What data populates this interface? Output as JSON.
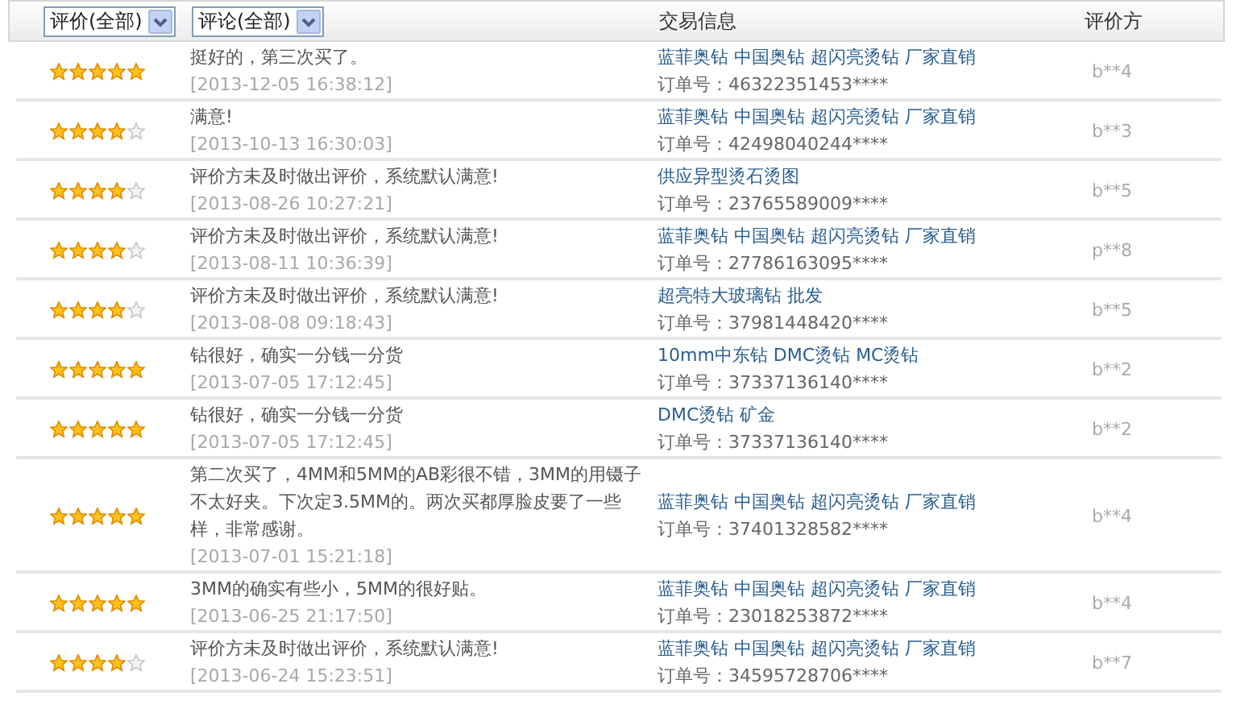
{
  "header": {
    "filters": [
      {
        "label": "评价(全部)"
      },
      {
        "label": "评论(全部)"
      }
    ],
    "columns": [
      "交易信息",
      "评价方"
    ]
  },
  "reviews": [
    {
      "stars": 5,
      "comment": "挺好的，第三次买了。",
      "date": "[2013-12-05 16:38:12]",
      "product": "蓝菲奥钻 中国奥钻 超闪亮烫钻 厂家直销",
      "order": "订单号：46322351453****",
      "rater": "b**4"
    },
    {
      "stars": 4,
      "comment": "满意!",
      "date": "[2013-10-13 16:30:03]",
      "product": "蓝菲奥钻 中国奥钻 超闪亮烫钻 厂家直销",
      "order": "订单号：42498040244****",
      "rater": "b**3"
    },
    {
      "stars": 4,
      "comment": "评价方未及时做出评价，系统默认满意!",
      "date": "[2013-08-26 10:27:21]",
      "product": "供应异型烫石烫图",
      "order": "订单号：23765589009****",
      "rater": "b**5"
    },
    {
      "stars": 4,
      "comment": "评价方未及时做出评价，系统默认满意!",
      "date": "[2013-08-11 10:36:39]",
      "product": "蓝菲奥钻 中国奥钻 超闪亮烫钻 厂家直销",
      "order": "订单号：27786163095****",
      "rater": "p**8"
    },
    {
      "stars": 4,
      "comment": "评价方未及时做出评价，系统默认满意!",
      "date": "[2013-08-08 09:18:43]",
      "product": "超亮特大玻璃钻 批发",
      "order": "订单号：37981448420****",
      "rater": "b**5"
    },
    {
      "stars": 5,
      "comment": "钻很好，确实一分钱一分货",
      "date": "[2013-07-05 17:12:45]",
      "product": "10mm中东钻 DMC烫钻 MC烫钻",
      "order": "订单号：37337136140****",
      "rater": "b**2"
    },
    {
      "stars": 5,
      "comment": "钻很好，确实一分钱一分货",
      "date": "[2013-07-05 17:12:45]",
      "product": "DMC烫钻 矿金",
      "order": "订单号：37337136140****",
      "rater": "b**2"
    },
    {
      "stars": 5,
      "comment": "第二次买了，4MM和5MM的AB彩很不错，3MM的用镊子不太好夹。下次定3.5MM的。两次买都厚脸皮要了一些样，非常感谢。",
      "date": "[2013-07-01 15:21:18]",
      "product": "蓝菲奥钻 中国奥钻 超闪亮烫钻 厂家直销",
      "order": "订单号：37401328582****",
      "rater": "b**4"
    },
    {
      "stars": 5,
      "comment": "3MM的确实有些小，5MM的很好贴。",
      "date": "[2013-06-25 21:17:50]",
      "product": "蓝菲奥钻 中国奥钻 超闪亮烫钻 厂家直销",
      "order": "订单号：23018253872****",
      "rater": "b**4"
    },
    {
      "stars": 4,
      "comment": "评价方未及时做出评价，系统默认满意!",
      "date": "[2013-06-24 15:23:51]",
      "product": "蓝菲奥钻 中国奥钻 超闪亮烫钻 厂家直销",
      "order": "订单号：34595728706****",
      "rater": "b**7"
    }
  ]
}
